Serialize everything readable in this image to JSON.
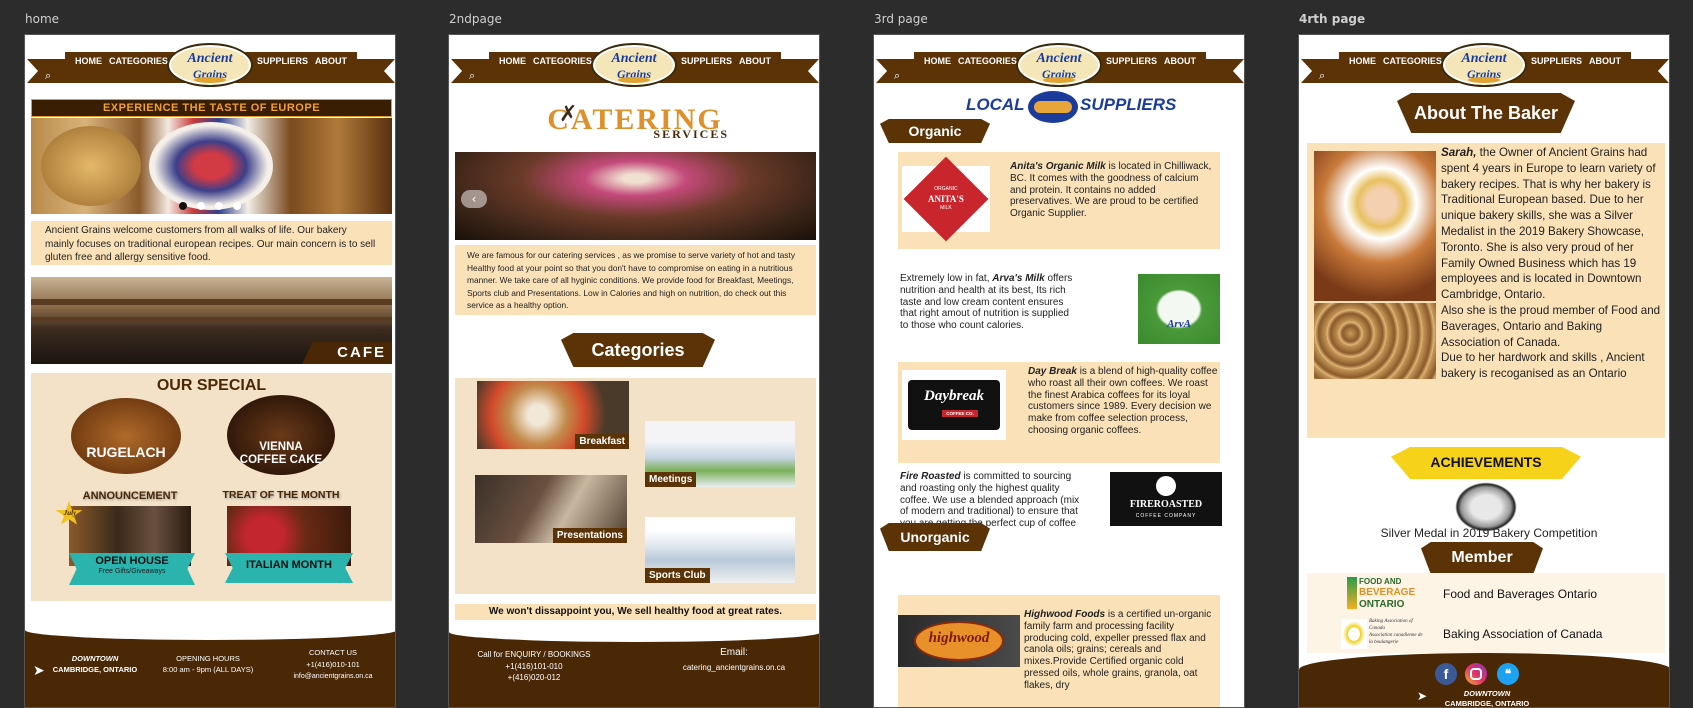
{
  "artboards": [
    {
      "label": "home"
    },
    {
      "label": "2ndpage"
    },
    {
      "label": "3rd page"
    },
    {
      "label": "4rth page"
    }
  ],
  "nav": {
    "home": "HOME",
    "categories": "CATEGORIES",
    "suppliers": "SUPPLIERS",
    "about": "ABOUT",
    "logo_line1": "Ancient",
    "logo_line2": "Grains",
    "search_icon": "search-icon"
  },
  "home": {
    "banner": "EXPERIENCE THE TASTE OF EUROPE",
    "intro": "Ancient Grains welcome customers from all walks of life. Our bakery mainly focuses on traditional european recipes. Our main concern is to sell gluten free and allergy sensitive food.",
    "cafe": "CAFE",
    "special_title": "OUR SPECIAL",
    "special1": "RUGELACH",
    "special2": "VIENNA COFFEE CAKE",
    "announcement": "ANNOUNCEMENT",
    "announce_badge": "July",
    "open_house": "OPEN HOUSE",
    "open_house_sub": "Free Gifts/Giveaways",
    "treat": "TREAT OF THE MONTH",
    "italian": "ITALIAN MONTH",
    "footer": {
      "loc1": "DOWNTOWN",
      "loc2": "CAMBRIDGE, ONTARIO",
      "hours_title": "OPENING HOURS",
      "hours": "8:00 am - 9pm (ALL DAYS)",
      "contact_title": "CONTACT US",
      "phone": "+1(416)010-101",
      "email": "info@ancientgrains.on.ca"
    }
  },
  "page2": {
    "title1": "CATERING",
    "title2": "SERVICES",
    "text": "We are famous for our catering services , as we promise to serve variety of hot and tasty Healthy food at your point so that you don't have to compromise on eating in a nutritious manner. We take care of all hyginic conditions. We provide food for Breakfast, Meetings, Sports club and Presentations. Low in Calories and high on nutrition, do check out this service as a healthy option.",
    "categories": "Categories",
    "cat_breakfast": "Breakfast",
    "cat_meetings": "Meetings",
    "cat_presentations": "Presentations",
    "cat_sports": "Sports Club",
    "tagline": "We won't dissappoint you, We sell healthy food at great rates.",
    "footer": {
      "call": "Call for ENQUIRY / BOOKINGS",
      "phone1": "+1(416)101-010",
      "phone2": "+(416)020-012",
      "email_title": "Email:",
      "email": "catering_ancientgrains.on.ca"
    }
  },
  "page3": {
    "title_local": "LOCAL",
    "title_suppliers": "SUPPLIERS",
    "organic": "Organic",
    "anita_name": "Anita's Organic Milk",
    "anita_text": " is located in Chilliwack, BC. It comes with the goodness of calcium and protein. It contains no added preservatives. We are proud to be certified Organic Supplier.",
    "anita_logo_top": "ORGANIC",
    "anita_logo": "ANITA'S",
    "anita_logo_bot": "MILK",
    "arva_pre": "Extremely low in fat, ",
    "arva_name": "Arva's Milk",
    "arva_text": " offers nutrition and health at its best, Its rich taste and low cream content ensures that right amout of nutrition is supplied to those who count calories.",
    "arva_logo": "ArvA",
    "daybreak_name": "Day Break",
    "daybreak_text": " is a blend of high-quality coffee who roast all their own coffees. We roast the finest Arabica coffees for its loyal customers since 1989. Every decision we make from coffee selection process, choosing organic coffees.",
    "daybreak_logo": "Daybreak",
    "daybreak_logo_sub": "COFFEE CO.",
    "fire_name": "Fire Roasted",
    "fire_text": " is committed to sourcing and roasting only the highest quality coffee. We use a blended approach (mix of modern and traditional) to ensure that you are getting the perfect cup of coffee every time.",
    "fire_logo": "FIREROASTED",
    "fire_logo_sub": "COFFEE COMPANY",
    "unorganic": "Unorganic",
    "highwood_name": "Highwood Foods",
    "highwood_text": " is a certified un-organic family farm and processing facility producing cold, expeller pressed flax and canola oils; grains; cereals and mixes.Provide Certified organic cold pressed oils, whole grains, granola, oat flakes, dry",
    "highwood_logo": "highwood"
  },
  "page4": {
    "about": "About The Baker",
    "name": "Sarah,",
    "bio1": " the Owner of Ancient Grains had spent 4 years in Europe to learn variety of bakery recipes. That is why her bakery is Traditional European based. Due to her unique bakery skills, she was a Silver Medalist in the 2019 Bakery Showcase, Toronto. She is also very proud of her Family Owned Business which has 19 employees and is located in Downtown Cambridge, Ontario.",
    "bio2": "Also she is the proud member of Food and Baverages, Ontario and Baking Association of Canada.",
    "bio3": "Due to her hardwork and skills , Ancient bakery is recoganised as an Ontario",
    "achievements": "ACHIEVEMENTS",
    "medal": "Silver Medal in  2019 Bakery Competition",
    "member": "Member",
    "fbo_logo1": "FOOD AND",
    "fbo_logo2": "BEVERAGE",
    "fbo_logo3": "ONTARIO",
    "fbo": "Food and Baverages Ontario",
    "bac_logo": "Baking Association of Canada",
    "bac_logo_fr": "Association canadienne de la boulangerie",
    "bac": "Baking Association of Canada",
    "footer_loc1": "DOWNTOWN",
    "footer_loc2": "CAMBRIDGE, ONTARIO"
  },
  "colors": {
    "brown": "#5b3307",
    "peach": "#fbe1b8",
    "orange": "#e0902a",
    "blue": "#1b3c9b"
  }
}
